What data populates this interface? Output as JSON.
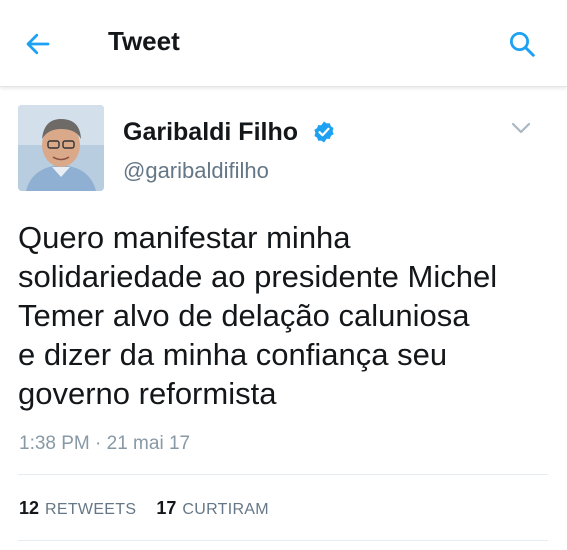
{
  "header": {
    "title": "Tweet",
    "back_icon": "arrow-left-icon",
    "search_icon": "search-icon"
  },
  "tweet": {
    "author_name": "Garibaldi Filho",
    "handle": "@garibaldifilho",
    "verified": true,
    "text": "Quero manifestar minha\nsolidariedade ao presidente Michel\nTemer alvo de delação caluniosa\ne dizer da minha confiança seu\ngoverno reformista",
    "timestamp": "1:38 PM · 21 mai 17",
    "retweets_count": "12",
    "retweets_label": "RETWEETS",
    "likes_count": "17",
    "likes_label": "CURTIRAM"
  },
  "colors": {
    "accent": "#1da1f2",
    "text": "#14171a",
    "secondary": "#657786"
  }
}
